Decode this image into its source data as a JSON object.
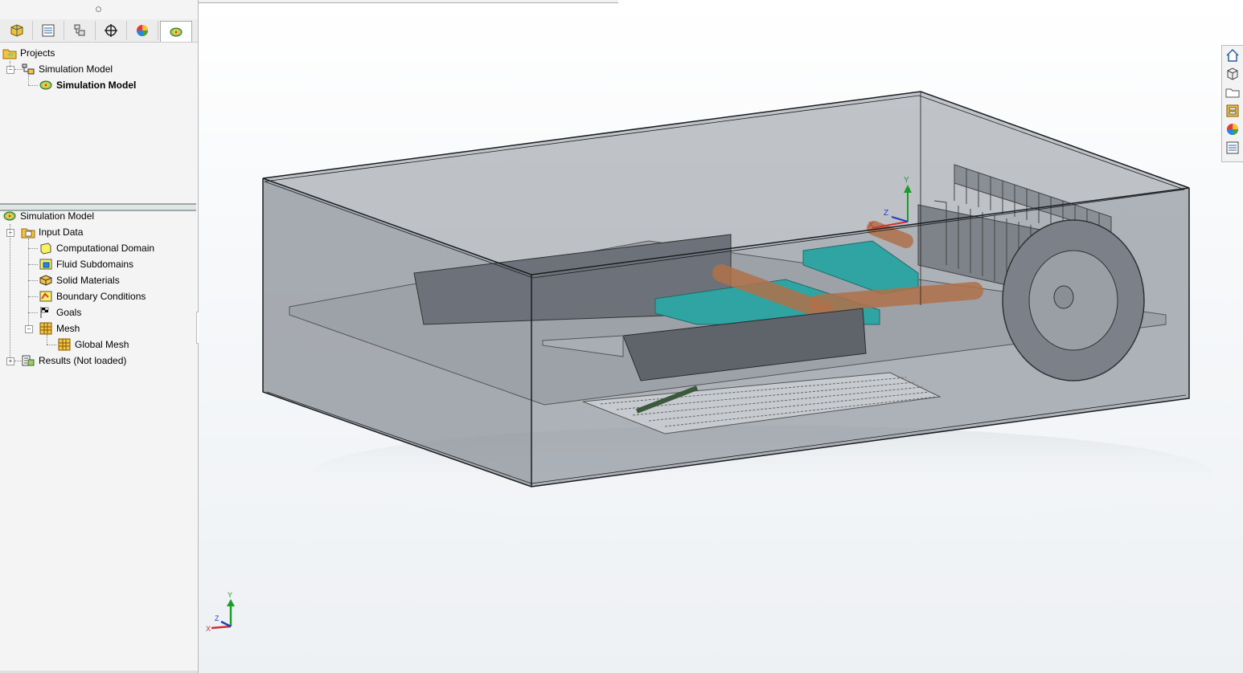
{
  "projects_tree": {
    "root_label": "Projects",
    "items": [
      {
        "label": "Simulation Model",
        "bold": false
      },
      {
        "label": "Simulation Model",
        "bold": true
      }
    ]
  },
  "analysis_tree": {
    "root_label": "Simulation Model",
    "input_data": "Input Data",
    "children": [
      {
        "label": "Computational Domain",
        "icon": "domain-icon"
      },
      {
        "label": "Fluid Subdomains",
        "icon": "fluid-subdomain-icon"
      },
      {
        "label": "Solid Materials",
        "icon": "solid-material-icon"
      },
      {
        "label": "Boundary Conditions",
        "icon": "boundary-condition-icon"
      },
      {
        "label": "Goals",
        "icon": "goals-flag-icon"
      },
      {
        "label": "Mesh",
        "icon": "mesh-icon"
      }
    ],
    "global_mesh": "Global Mesh",
    "results": "Results (Not loaded)"
  },
  "manager_tabs": [
    "feature-manager-icon",
    "property-manager-icon",
    "configuration-manager-icon",
    "dimxpert-icon",
    "display-manager-icon",
    "flow-simulation-icon"
  ],
  "right_toolbar": [
    "home-icon",
    "3d-views-icon",
    "folder-icon",
    "view-palette-icon",
    "appearances-icon",
    "custom-properties-icon"
  ],
  "triad_labels": {
    "y": "Y",
    "x": "X",
    "z": "Z"
  },
  "colors": {
    "enclosure": "#8b9098",
    "board": "#9ea3aa",
    "chip": "#2fa4a2",
    "heatpipe": "#b0714a"
  }
}
